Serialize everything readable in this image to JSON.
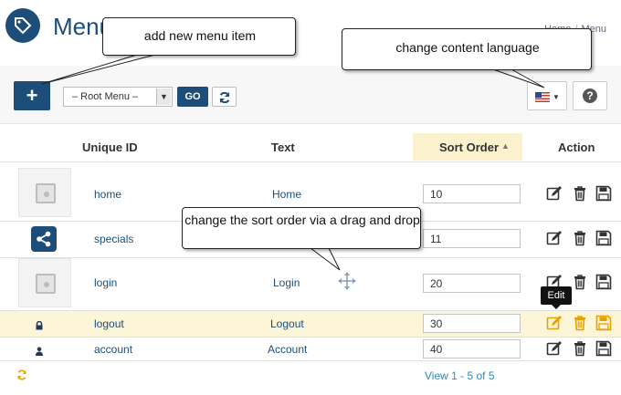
{
  "header": {
    "title": "Menu",
    "breadcrumbs": [
      "Home",
      "Menu"
    ],
    "logo_icon": "tag-icon"
  },
  "toolbar": {
    "add_label": "+",
    "menu_select_value": "– Root Menu –",
    "go_label": "GO",
    "refresh_icon": "refresh-icon",
    "language_icon": "us-flag-icon",
    "help_label": "?"
  },
  "table": {
    "columns": {
      "unique_id": "Unique ID",
      "text": "Text",
      "sort_order": "Sort Order",
      "action": "Action"
    },
    "rows": [
      {
        "id": "home",
        "text": "Home",
        "sort": "10",
        "icon": "page-thumbnail-icon"
      },
      {
        "id": "specials",
        "text": "",
        "sort": "11",
        "icon": "share-icon"
      },
      {
        "id": "login",
        "text": "Login",
        "sort": "20",
        "icon": "page-thumbnail-icon"
      },
      {
        "id": "logout",
        "text": "Logout",
        "sort": "30",
        "icon": "lock-icon"
      },
      {
        "id": "account",
        "text": "Account",
        "sort": "40",
        "icon": "user-icon"
      }
    ],
    "action_icons": [
      "edit-icon",
      "trash-icon",
      "save-icon"
    ],
    "edit_tooltip": "Edit"
  },
  "footer": {
    "pager_text": "View 1 - 5 of 5",
    "reload_icon": "reload-icon"
  },
  "callouts": {
    "add": "add new menu item",
    "language": "change content language",
    "drag": "change the sort order via a drag and drop"
  },
  "colors": {
    "brand": "#1d4e7a",
    "sort_header_bg": "#fbf1cc",
    "highlight_row": "#fcf5d8",
    "action_hover": "#e8a100"
  }
}
